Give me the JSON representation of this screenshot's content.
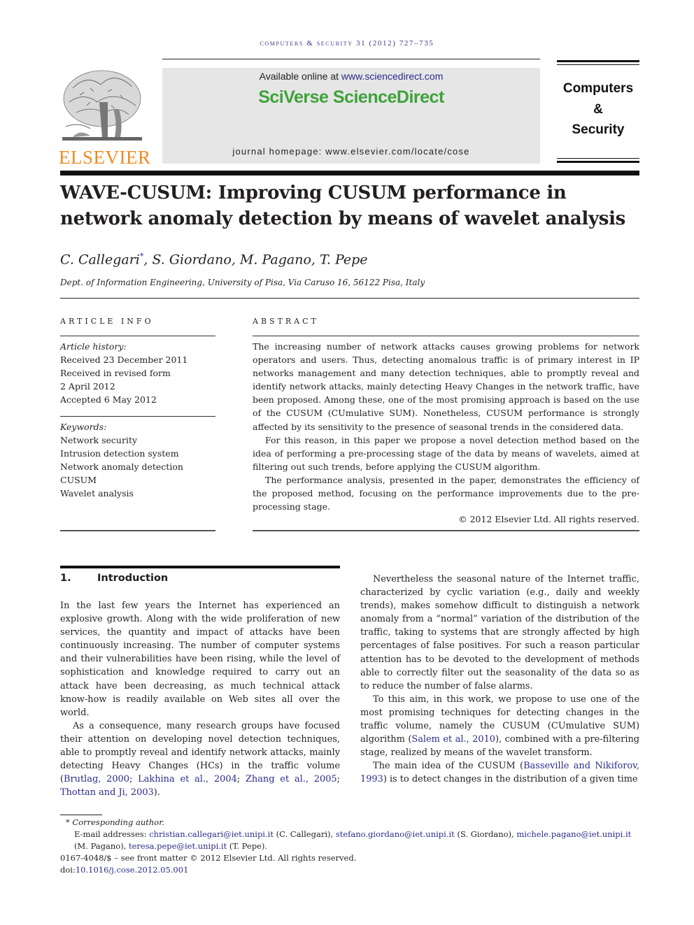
{
  "running_head": "COMPUTERS & SECURITY 31 (2012) 727–735",
  "publisher": {
    "logo_word": "ELSEVIER",
    "logo_color": "#f28a1f"
  },
  "sciencedirect": {
    "available_prefix": "Available online at ",
    "available_link": "www.sciencedirect.com",
    "brand": "SciVerse ScienceDirect",
    "brand_color": "#3ea23a",
    "homepage": "journal homepage: www.elsevier.com/locate/cose"
  },
  "journal": {
    "line1": "Computers",
    "line2": "&",
    "line3": "Security"
  },
  "article": {
    "title": "WAVE-CUSUM: Improving CUSUM performance in network anomaly detection by means of wavelet analysis",
    "authors": [
      {
        "name": "C. Callegari",
        "mark": "*"
      },
      {
        "name": "S. Giordano",
        "mark": ""
      },
      {
        "name": "M. Pagano",
        "mark": ""
      },
      {
        "name": "T. Pepe",
        "mark": ""
      }
    ],
    "affiliation": "Dept. of Information Engineering, University of Pisa, Via Caruso 16, 56122 Pisa, Italy"
  },
  "article_info": {
    "heading": "ARTICLE INFO",
    "history_label": "Article history:",
    "history": [
      "Received 23 December 2011",
      "Received in revised form",
      "2 April 2012",
      "Accepted 6 May 2012"
    ],
    "keywords_label": "Keywords:",
    "keywords": [
      "Network security",
      "Intrusion detection system",
      "Network anomaly detection",
      "CUSUM",
      "Wavelet analysis"
    ]
  },
  "abstract": {
    "heading": "ABSTRACT",
    "paragraphs": [
      "The increasing number of network attacks causes growing problems for network operators and users. Thus, detecting anomalous traffic is of primary interest in IP networks management and many detection techniques, able to promptly reveal and identify network attacks, mainly detecting Heavy Changes in the network traffic, have been proposed. Among these, one of the most promising approach is based on the use of the CUSUM (CUmulative SUM). Nonetheless, CUSUM performance is strongly affected by its sensitivity to the presence of seasonal trends in the considered data.",
      "For this reason, in this paper we propose a novel detection method based on the idea of performing a pre-processing stage of the data by means of wavelets, aimed at filtering out such trends, before applying the CUSUM algorithm.",
      "The performance analysis, presented in the paper, demonstrates the efficiency of the proposed method, focusing on the performance improvements due to the pre-processing stage."
    ],
    "copyright": "© 2012 Elsevier Ltd. All rights reserved."
  },
  "section": {
    "number": "1.",
    "title": "Introduction"
  },
  "body": {
    "left_p1": "In the last few years the Internet has experienced an explosive growth. Along with the wide proliferation of new services, the quantity and impact of attacks have been continuously increasing. The number of computer systems and their vulnerabilities have been rising, while the level of sophistication and knowledge required to carry out an attack have been decreasing, as much technical attack know-how is readily available on Web sites all over the world.",
    "left_p2_text": "As a consequence, many research groups have focused their attention on developing novel detection techniques, able to promptly reveal and identify network attacks, mainly detecting Heavy Changes (HCs) in the traffic volume (",
    "left_p2_refs": [
      "Brutlag, 2000",
      "Lakhina et al., 2004",
      "Zhang et al., 2005",
      "Thottan and Ji, 2003"
    ],
    "left_p2_end": ").",
    "right_p1": "Nevertheless the seasonal nature of the Internet traffic, characterized by cyclic variation (e.g., daily and weekly trends), makes somehow difficult to distinguish a network anomaly from a “normal” variation of the distribution of the traffic, taking to systems that are strongly affected by high percentages of false positives. For such a reason particular attention has to be devoted to the development of methods able to correctly filter out the seasonality of the data so as to reduce the number of false alarms.",
    "right_p2_a": "To this aim, in this work, we propose to use one of the most promising techniques for detecting changes in the traffic volume, namely the CUSUM (CUmulative SUM) algorithm (",
    "right_p2_ref": "Salem et al., 2010",
    "right_p2_b": "), combined with a pre-filtering stage, realized by means of the wavelet transform.",
    "right_p3_a": "The main idea of the CUSUM (",
    "right_p3_ref": "Basseville and Nikiforov, 1993",
    "right_p3_b": ") is to detect changes in the distribution of a given time"
  },
  "footnotes": {
    "corresponding": "Corresponding author.",
    "corresponding_mark": "*",
    "email_label": "E-mail addresses: ",
    "emails": [
      {
        "address": "christian.callegari@iet.unipi.it",
        "who": "(C. Callegari)"
      },
      {
        "address": "stefano.giordano@iet.unipi.it",
        "who": "(S. Giordano)"
      },
      {
        "address": "michele.pagano@iet.unipi.it",
        "who": "(M. Pagano)"
      },
      {
        "address": "teresa.pepe@iet.unipi.it",
        "who": "(T. Pepe)."
      }
    ],
    "front_matter": "0167-4048/$ – see front matter © 2012 Elsevier Ltd. All rights reserved.",
    "doi_prefix": "doi:",
    "doi": "10.1016/j.cose.2012.05.001"
  }
}
